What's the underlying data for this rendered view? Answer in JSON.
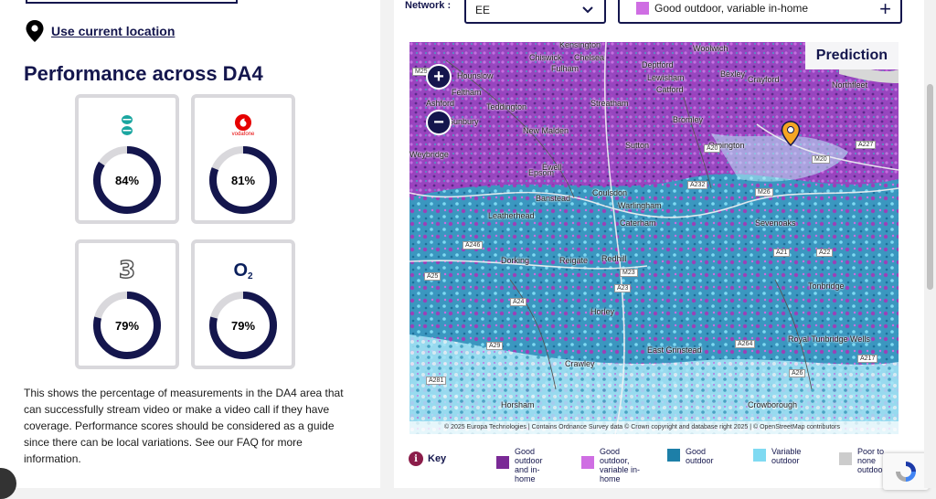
{
  "location": {
    "link": "Use current location"
  },
  "heading": "Performance across DA4",
  "cards": [
    {
      "network": "EE",
      "percent": "84%",
      "value": 84,
      "logo": "ee-logo"
    },
    {
      "network": "Vodafone",
      "percent": "81%",
      "value": 81,
      "logo": "vodafone-logo",
      "logo_text": "vodafone"
    },
    {
      "network": "Three",
      "percent": "79%",
      "value": 79,
      "logo": "three-logo",
      "logo_text": "3"
    },
    {
      "network": "O2",
      "percent": "79%",
      "value": 79,
      "logo": "o2-logo",
      "logo_text": "O",
      "logo_sub": "2"
    }
  ],
  "description": "This shows the percentage of measurements in the DA4 area that can successfully stream video or make a video call if they have coverage. Performance scores should be considered as a guide since there can be local variations. See our FAQ for more information.",
  "controls": {
    "network_label": "Network :",
    "network_value": "EE",
    "coverage_value": "Good outdoor, variable in-home",
    "plus": "+"
  },
  "map": {
    "prediction": "Prediction",
    "zoom_in": "+",
    "zoom_out": "−",
    "attribution": "© 2025 Europa Technologies | Contains Ordnance Survey data © Crown copyright and database right 2025 | © OpenStreetMap contributors",
    "towns": [
      "Kensington",
      "Woolwich",
      "Chiswick",
      "Chelsea",
      "Hounslow",
      "Fulham",
      "Deptford",
      "Bexley",
      "Crayford",
      "Northfleet",
      "Feltham",
      "Lewisham",
      "Catford",
      "Teddington",
      "Streatham",
      "Ashford",
      "Bromley",
      "Sunbury",
      "New Malden",
      "Sutton",
      "Orpington",
      "Weybridge",
      "Epsom",
      "Ewell",
      "Banstead",
      "Coulsdon",
      "Sevenoaks",
      "Leatherhead",
      "Warlingham",
      "Caterham",
      "Dorking",
      "Reigate",
      "Redhill",
      "Tonbridge",
      "Horley",
      "Royal Tunbridge Wells",
      "East Grinstead",
      "Crawley",
      "Horsham",
      "Crowborough"
    ],
    "roads": [
      "M25",
      "M23",
      "A20",
      "A21",
      "M20",
      "A227",
      "A232",
      "A23",
      "A24",
      "A25",
      "A26",
      "A29",
      "A264",
      "A246",
      "A217",
      "A22",
      "A281",
      "M26"
    ]
  },
  "key": {
    "title": "Key",
    "items": [
      {
        "label": "Good outdoor and in-home",
        "color": "#7a2a96"
      },
      {
        "label": "Good outdoor, variable in-home",
        "color": "#cf6ee3"
      },
      {
        "label": "Good outdoor",
        "color": "#1d7fa8"
      },
      {
        "label": "Variable outdoor",
        "color": "#7fdaf2"
      },
      {
        "label": "Poor to none outdoor",
        "color": "#cccccc"
      }
    ]
  },
  "colors": {
    "brand": "#14164d",
    "donut_fill": "#14164d",
    "donut_track": "#d9d8dc"
  }
}
